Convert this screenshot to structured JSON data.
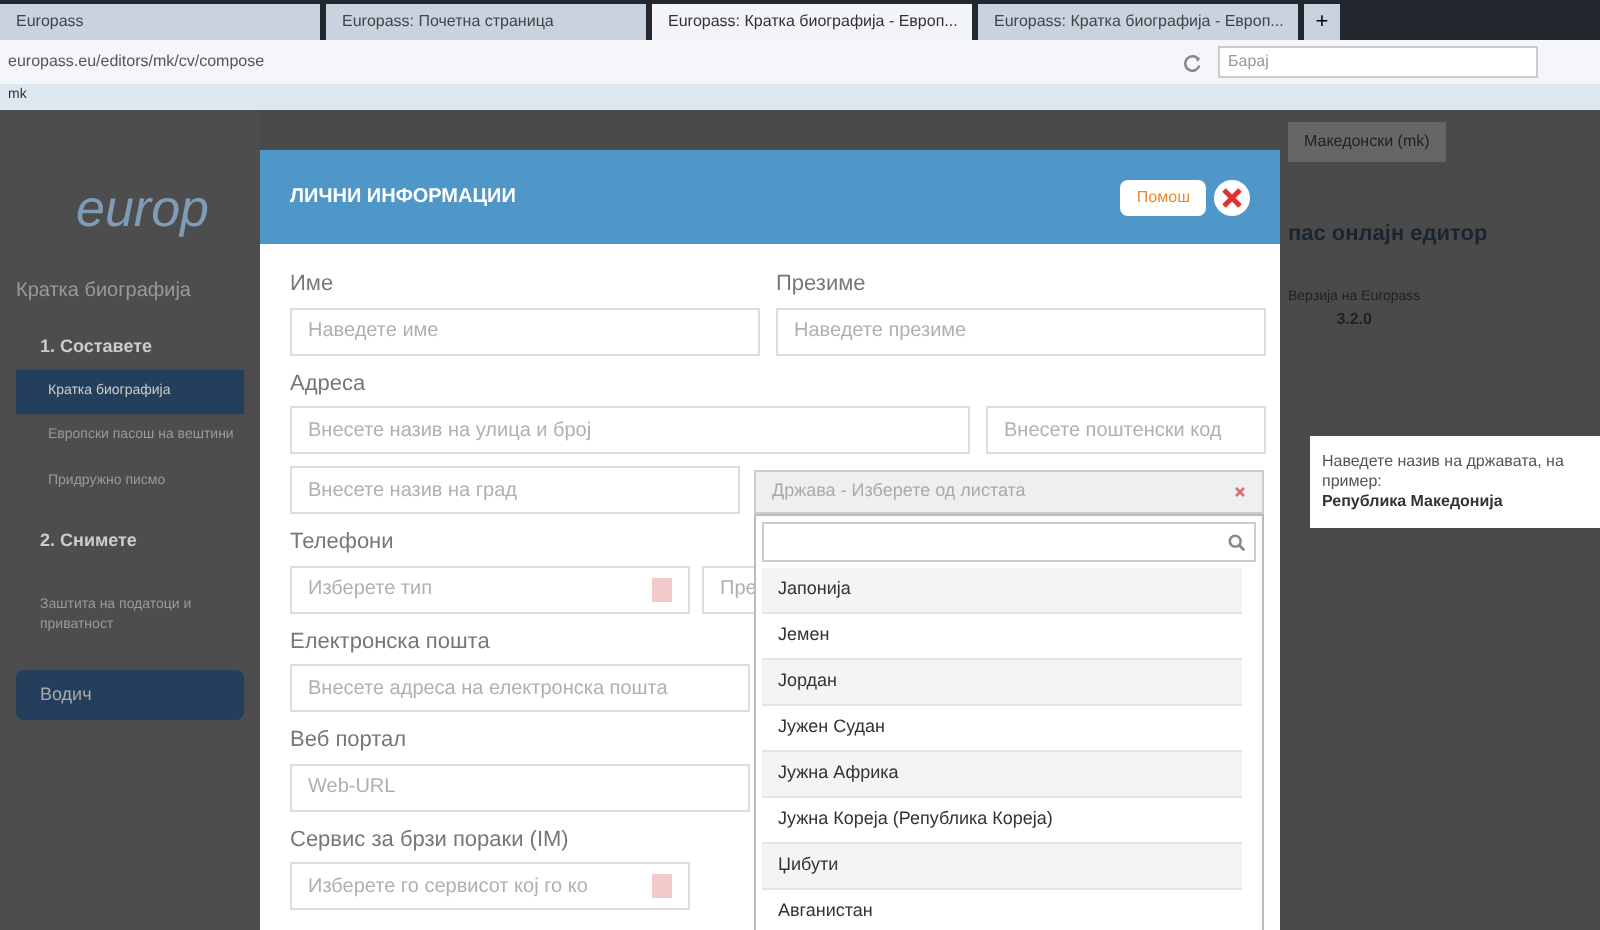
{
  "browser": {
    "tabs": [
      {
        "label": "Europass",
        "selected": false
      },
      {
        "label": "Europass: Почетна страница",
        "selected": false
      },
      {
        "label": "Europass: Кратка биографија - Европ...",
        "selected": true
      },
      {
        "label": "Europass: Кратка биографија - Европ...",
        "selected": false
      }
    ],
    "new_tab": "+",
    "url": "europass.eu/editors/mk/cv/compose",
    "search_placeholder": "Барај",
    "bookmark": "mk"
  },
  "page": {
    "logo": "europ",
    "subtitle": "Кратка биографија",
    "language": "Македонски (mk)",
    "editor_title": "пас онлајн едитор",
    "version": "Верзија на Europass",
    "version_number": "3.2.0",
    "nav": [
      {
        "label": "1. Составете",
        "kind": "section",
        "children": [
          {
            "label": "Кратка биографија",
            "selected": true
          },
          {
            "label": "Европски пасош на вештини",
            "selected": false
          },
          {
            "label": "Придружно писмо",
            "selected": false
          }
        ]
      },
      {
        "label": "2. Снимете",
        "kind": "section"
      },
      {
        "label": "Заштита на податоци и приватност",
        "kind": "link"
      },
      {
        "label": "Водич",
        "kind": "button"
      }
    ]
  },
  "dialog": {
    "title": "ЛИЧНИ ИНФОРМАЦИИ",
    "help": "Помош",
    "name": {
      "label": "Име",
      "placeholder": "Наведете име"
    },
    "surname": {
      "label": "Презиме",
      "placeholder": "Наведете презиме"
    },
    "address": {
      "label": "Адреса",
      "street": "Внесете назив на улица и број",
      "postal": "Внесете поштенски код",
      "city": "Внесете назив на град",
      "country": "Држава - Изберете од листата"
    },
    "phones": {
      "label": "Телефони",
      "type": "Изберете тип",
      "number": "Пре"
    },
    "email": {
      "label": "Електронска пошта",
      "placeholder": "Внесете адреса на електронска пошта"
    },
    "web": {
      "label": "Веб портал",
      "placeholder": "Web-URL"
    },
    "im": {
      "label": "Сервис за брзи пораки (IM)",
      "placeholder": "Изберете го сервисот кој го ко"
    }
  },
  "dropdown": {
    "options": [
      "Јапонија",
      "Јемен",
      "Јордан",
      "Јужен Судан",
      "Јужна Африка",
      "Јужна Кореја (Република Кореја)",
      "Џибути",
      "Авганистан"
    ]
  },
  "tooltip": {
    "text": "Наведете назив на државата, на пример:",
    "example": "Република Македонија"
  }
}
